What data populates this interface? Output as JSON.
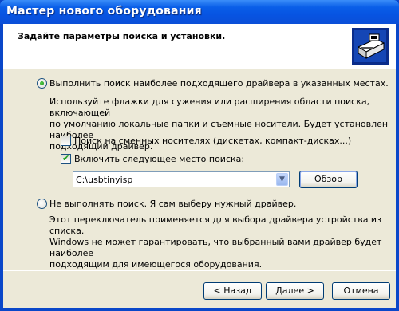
{
  "window": {
    "title": "Мастер нового оборудования"
  },
  "header": {
    "heading": "Задайте параметры поиска и установки.",
    "icon": "hardware-wizard-icon"
  },
  "option_search": {
    "label": "Выполнить поиск наиболее подходящего драйвера в указанных местах.",
    "selected": true,
    "description_lines": [
      "Используйте флажки для сужения или расширения области поиска, включающей",
      "по умолчанию локальные папки и съемные носители. Будет установлен наиболее",
      "подходящий драйвер."
    ],
    "removable_media": {
      "label": "Поиск на сменных носителях (дискетах, компакт-дисках...)",
      "checked": false
    },
    "include_location": {
      "label": "Включить следующее место поиска:",
      "checked": true
    },
    "path_value": "C:\\usbtinyisp",
    "browse_label": "Обзор"
  },
  "option_manual": {
    "label": "Не выполнять поиск. Я сам выберу нужный драйвер.",
    "selected": false,
    "description_lines": [
      "Этот переключатель применяется для выбора драйвера устройства из списка.",
      "Windows не может гарантировать, что выбранный вами драйвер будет наиболее",
      "подходящим для имеющегося оборудования."
    ]
  },
  "footer": {
    "back_label": "< Назад",
    "next_label": "Далее >",
    "cancel_label": "Отмена"
  },
  "colors": {
    "titlebar": "#0754e2",
    "dialog_bg": "#ece9d8"
  }
}
